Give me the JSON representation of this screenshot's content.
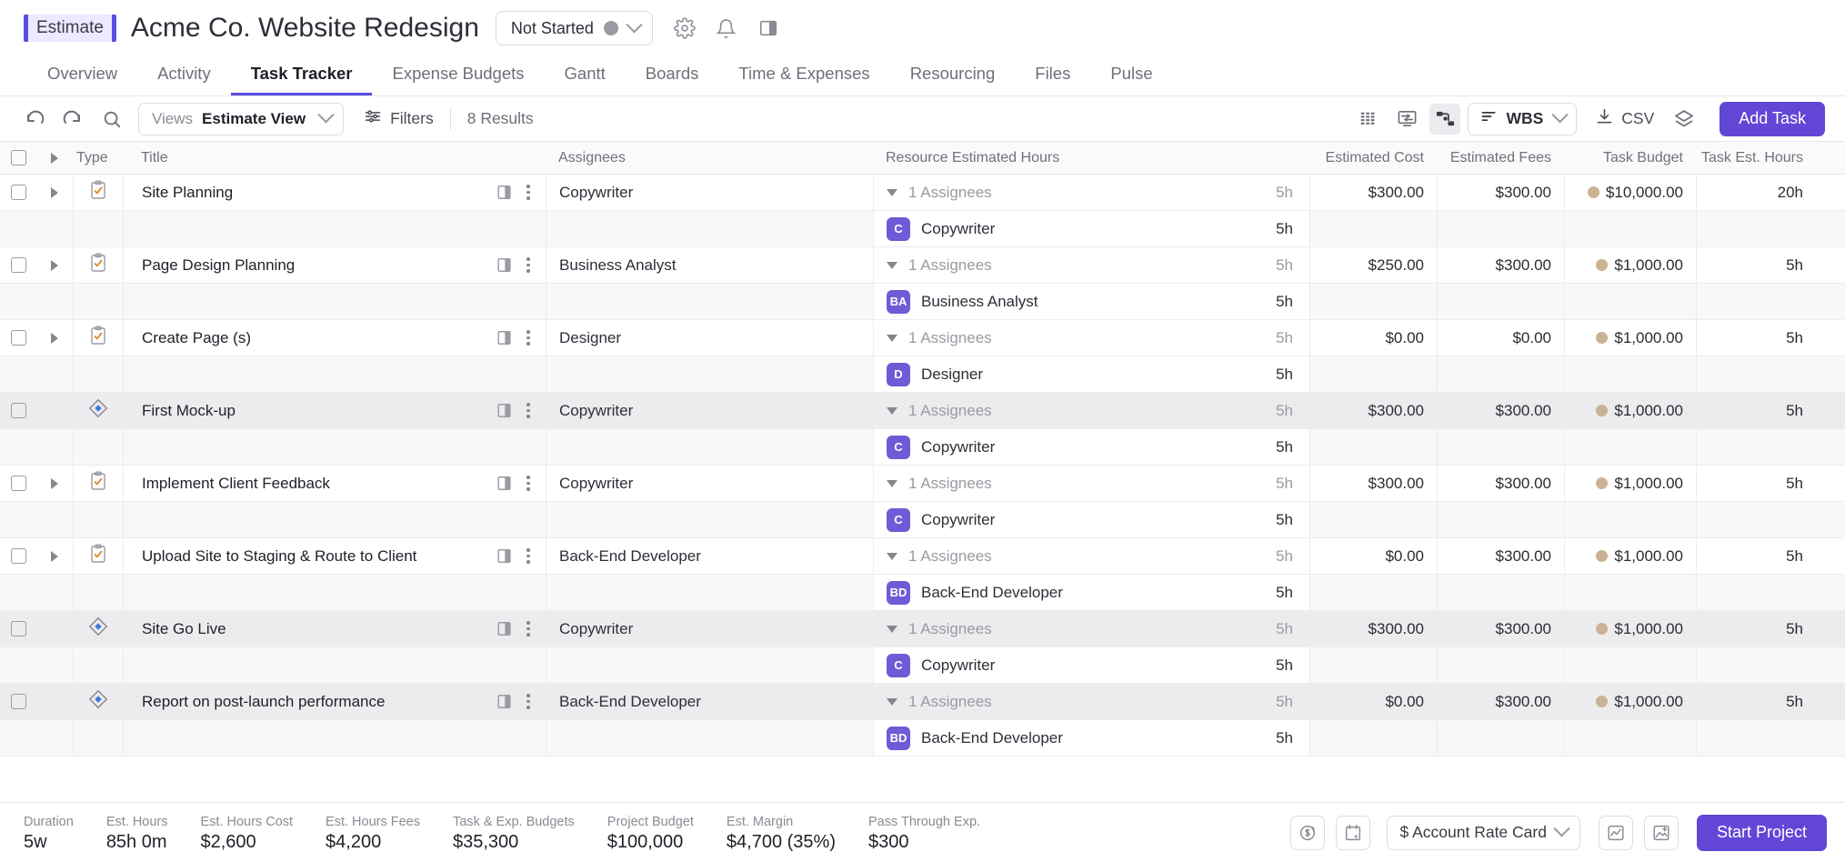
{
  "header": {
    "badge": "Estimate",
    "title": "Acme Co. Website Redesign",
    "status": "Not Started",
    "icons": [
      "gear-icon",
      "bell-icon",
      "panel-icon"
    ]
  },
  "tabs": [
    {
      "label": "Overview",
      "active": false
    },
    {
      "label": "Activity",
      "active": false
    },
    {
      "label": "Task Tracker",
      "active": true
    },
    {
      "label": "Expense Budgets",
      "active": false
    },
    {
      "label": "Gantt",
      "active": false
    },
    {
      "label": "Boards",
      "active": false
    },
    {
      "label": "Time & Expenses",
      "active": false
    },
    {
      "label": "Resourcing",
      "active": false
    },
    {
      "label": "Files",
      "active": false
    },
    {
      "label": "Pulse",
      "active": false
    }
  ],
  "toolbar": {
    "undo": "undo-icon",
    "redo": "redo-icon",
    "search": "search-icon",
    "views_label": "Views",
    "views_value": "Estimate View",
    "filters_label": "Filters",
    "results": "8 Results",
    "wbs_label": "WBS",
    "csv_label": "CSV",
    "add_task_label": "Add Task"
  },
  "table": {
    "columns": [
      "Type",
      "Title",
      "Assignees",
      "Resource Estimated Hours",
      "Estimated Cost",
      "Estimated Fees",
      "Task Budget",
      "Task Est. Hours"
    ],
    "assignees_collapsed_label": "1 Assignees",
    "rows": [
      {
        "type": "task",
        "title": "Site Planning",
        "assignee": "Copywriter",
        "res_label": "1 Assignees",
        "res_hours": "5h",
        "cost": "$300.00",
        "fees": "$300.00",
        "budget": "$10,000.00",
        "est_hours": "20h",
        "sub": {
          "initials": "C",
          "name": "Copywriter",
          "hours": "5h"
        },
        "alt": false
      },
      {
        "type": "task",
        "title": "Page Design Planning",
        "assignee": "Business Analyst",
        "res_label": "1 Assignees",
        "res_hours": "5h",
        "cost": "$250.00",
        "fees": "$300.00",
        "budget": "$1,000.00",
        "est_hours": "5h",
        "sub": {
          "initials": "BA",
          "name": "Business Analyst",
          "hours": "5h"
        },
        "alt": false
      },
      {
        "type": "task",
        "title": "Create Page (s)",
        "assignee": "Designer",
        "res_label": "1 Assignees",
        "res_hours": "5h",
        "cost": "$0.00",
        "fees": "$0.00",
        "budget": "$1,000.00",
        "est_hours": "5h",
        "sub": {
          "initials": "D",
          "name": "Designer",
          "hours": "5h"
        },
        "alt": false
      },
      {
        "type": "milestone",
        "title": "First Mock-up",
        "assignee": "Copywriter",
        "res_label": "1 Assignees",
        "res_hours": "5h",
        "cost": "$300.00",
        "fees": "$300.00",
        "budget": "$1,000.00",
        "est_hours": "5h",
        "sub": {
          "initials": "C",
          "name": "Copywriter",
          "hours": "5h"
        },
        "alt": true
      },
      {
        "type": "task",
        "title": "Implement Client Feedback",
        "assignee": "Copywriter",
        "res_label": "1 Assignees",
        "res_hours": "5h",
        "cost": "$300.00",
        "fees": "$300.00",
        "budget": "$1,000.00",
        "est_hours": "5h",
        "sub": {
          "initials": "C",
          "name": "Copywriter",
          "hours": "5h"
        },
        "alt": false
      },
      {
        "type": "task",
        "title": "Upload Site to Staging & Route to Client",
        "assignee": "Back-End Developer",
        "res_label": "1 Assignees",
        "res_hours": "5h",
        "cost": "$0.00",
        "fees": "$300.00",
        "budget": "$1,000.00",
        "est_hours": "5h",
        "sub": {
          "initials": "BD",
          "name": "Back-End Developer",
          "hours": "5h"
        },
        "alt": false
      },
      {
        "type": "milestone",
        "title": "Site Go Live",
        "assignee": "Copywriter",
        "res_label": "1 Assignees",
        "res_hours": "5h",
        "cost": "$300.00",
        "fees": "$300.00",
        "budget": "$1,000.00",
        "est_hours": "5h",
        "sub": {
          "initials": "C",
          "name": "Copywriter",
          "hours": "5h"
        },
        "alt": true
      },
      {
        "type": "milestone",
        "title": "Report on post-launch performance",
        "assignee": "Back-End Developer",
        "res_label": "1 Assignees",
        "res_hours": "5h",
        "cost": "$0.00",
        "fees": "$300.00",
        "budget": "$1,000.00",
        "est_hours": "5h",
        "sub": {
          "initials": "BD",
          "name": "Back-End Developer",
          "hours": "5h"
        },
        "alt": true
      }
    ]
  },
  "footer": {
    "stats": [
      {
        "label": "Duration",
        "value": "5w"
      },
      {
        "label": "Est. Hours",
        "value": "85h 0m"
      },
      {
        "label": "Est. Hours Cost",
        "value": "$2,600"
      },
      {
        "label": "Est. Hours Fees",
        "value": "$4,200"
      },
      {
        "label": "Task & Exp. Budgets",
        "value": "$35,300"
      },
      {
        "label": "Project Budget",
        "value": "$100,000"
      },
      {
        "label": "Est. Margin",
        "value": "$4,700 (35%)"
      },
      {
        "label": "Pass Through Exp.",
        "value": "$300"
      }
    ],
    "rate_card": "$ Account Rate Card",
    "start_button": "Start Project"
  },
  "colors": {
    "accent": "#6247d6",
    "badge_bg": "#eceaff",
    "avatar": "#6e5bd6",
    "budget_dot": "#cbb292",
    "milestone": "#3f78e0"
  }
}
